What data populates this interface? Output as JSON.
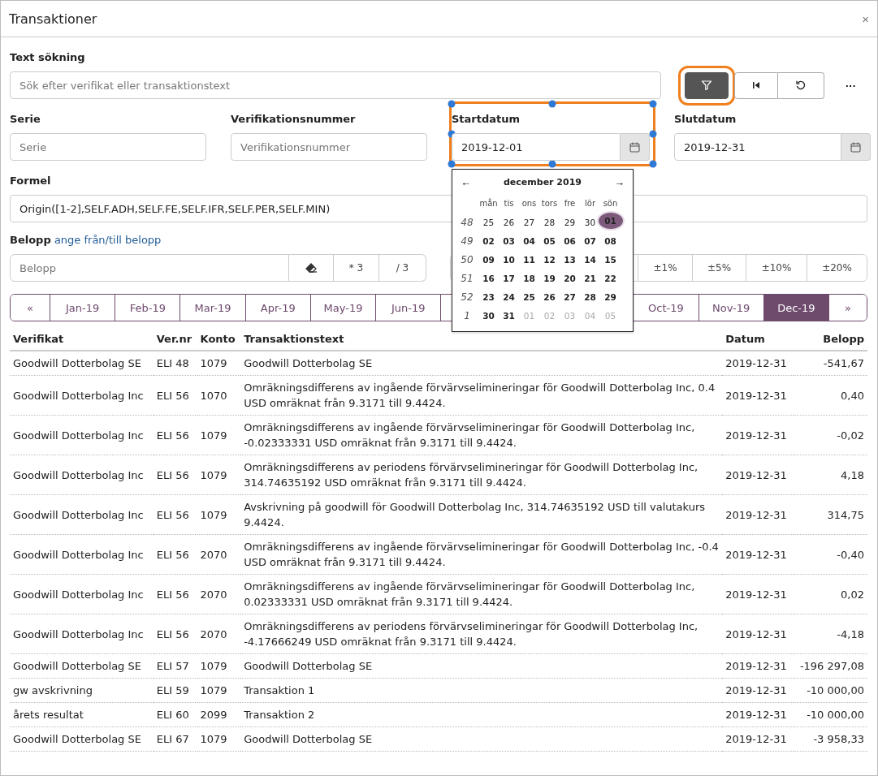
{
  "window": {
    "title": "Transaktioner",
    "close": "×"
  },
  "text_search": {
    "label": "Text sökning",
    "placeholder": "Sök efter verifikat eller transaktionstext"
  },
  "toolbar": {
    "buttons": [
      {
        "kind": "filter",
        "highlighted": true
      },
      {
        "kind": "first",
        "highlighted": false
      },
      {
        "kind": "reset",
        "highlighted": false
      }
    ],
    "more": "···"
  },
  "fields": [
    {
      "label": "Serie",
      "placeholder": "Serie",
      "kind": "text"
    },
    {
      "label": "Verifikationsnummer",
      "placeholder": "Verifikationsnummer",
      "kind": "text"
    },
    {
      "label": "Startdatum",
      "value": "2019-12-01",
      "kind": "date",
      "highlighted": true
    },
    {
      "label": "Slutdatum",
      "value": "2019-12-31",
      "kind": "date"
    }
  ],
  "calendar": {
    "title": "december 2019",
    "prev": "←",
    "next": "→",
    "weekdays": [
      "mån",
      "tis",
      "ons",
      "tors",
      "fre",
      "lör",
      "sön"
    ],
    "weeks": [
      {
        "week": "48",
        "days": [
          {
            "d": "25",
            "kind": "prev",
            "selected": false
          },
          {
            "d": "26",
            "kind": "prev",
            "selected": false
          },
          {
            "d": "27",
            "kind": "prev",
            "selected": false
          },
          {
            "d": "28",
            "kind": "prev",
            "selected": false
          },
          {
            "d": "29",
            "kind": "prev",
            "selected": false
          },
          {
            "d": "30",
            "kind": "prev",
            "selected": false
          },
          {
            "d": "01",
            "kind": "cur",
            "selected": true
          }
        ]
      },
      {
        "week": "49",
        "days": [
          {
            "d": "02",
            "kind": "cur",
            "selected": false
          },
          {
            "d": "03",
            "kind": "cur",
            "selected": false
          },
          {
            "d": "04",
            "kind": "cur",
            "selected": false
          },
          {
            "d": "05",
            "kind": "cur",
            "selected": false
          },
          {
            "d": "06",
            "kind": "cur",
            "selected": false
          },
          {
            "d": "07",
            "kind": "cur",
            "selected": false
          },
          {
            "d": "08",
            "kind": "cur",
            "selected": false
          }
        ]
      },
      {
        "week": "50",
        "days": [
          {
            "d": "09",
            "kind": "cur",
            "selected": false
          },
          {
            "d": "10",
            "kind": "cur",
            "selected": false
          },
          {
            "d": "11",
            "kind": "cur",
            "selected": false
          },
          {
            "d": "12",
            "kind": "cur",
            "selected": false
          },
          {
            "d": "13",
            "kind": "cur",
            "selected": false
          },
          {
            "d": "14",
            "kind": "cur",
            "selected": false
          },
          {
            "d": "15",
            "kind": "cur",
            "selected": false
          }
        ]
      },
      {
        "week": "51",
        "days": [
          {
            "d": "16",
            "kind": "cur",
            "selected": false
          },
          {
            "d": "17",
            "kind": "cur",
            "selected": false
          },
          {
            "d": "18",
            "kind": "cur",
            "selected": false
          },
          {
            "d": "19",
            "kind": "cur",
            "selected": false
          },
          {
            "d": "20",
            "kind": "cur",
            "selected": false
          },
          {
            "d": "21",
            "kind": "cur",
            "selected": false
          },
          {
            "d": "22",
            "kind": "cur",
            "selected": false
          }
        ]
      },
      {
        "week": "52",
        "days": [
          {
            "d": "23",
            "kind": "cur",
            "selected": false
          },
          {
            "d": "24",
            "kind": "cur",
            "selected": false
          },
          {
            "d": "25",
            "kind": "cur",
            "selected": false
          },
          {
            "d": "26",
            "kind": "cur",
            "selected": false
          },
          {
            "d": "27",
            "kind": "cur",
            "selected": false
          },
          {
            "d": "28",
            "kind": "cur",
            "selected": false
          },
          {
            "d": "29",
            "kind": "cur",
            "selected": false
          }
        ]
      },
      {
        "week": "1",
        "days": [
          {
            "d": "30",
            "kind": "cur",
            "selected": false
          },
          {
            "d": "31",
            "kind": "cur",
            "selected": false
          },
          {
            "d": "01",
            "kind": "next",
            "selected": false
          },
          {
            "d": "02",
            "kind": "next",
            "selected": false
          },
          {
            "d": "03",
            "kind": "next",
            "selected": false
          },
          {
            "d": "04",
            "kind": "next",
            "selected": false
          },
          {
            "d": "05",
            "kind": "next",
            "selected": false
          }
        ]
      }
    ]
  },
  "formula": {
    "label": "Formel",
    "value": "Origin([1-2],SELF.ADH,SELF.FE,SELF.IFR,SELF.PER,SELF.MIN)"
  },
  "amount": {
    "label": "Belopp",
    "link": "ange från/till belopp",
    "placeholder": "Belopp",
    "buttons": [
      {
        "kind": "eraser"
      },
      {
        "kind": "text",
        "label": "* 3"
      },
      {
        "kind": "text",
        "label": "/ 3"
      }
    ],
    "percent_buttons": [
      "±1%",
      "±5%",
      "±10%",
      "±20%"
    ]
  },
  "month_bar": {
    "start": [
      {
        "label": "«",
        "selected": false
      },
      {
        "label": "Jan-19",
        "selected": false
      },
      {
        "label": "Feb-19",
        "selected": false
      },
      {
        "label": "Mar-19",
        "selected": false
      },
      {
        "label": "Apr-19",
        "selected": false
      },
      {
        "label": "May-19",
        "selected": false
      },
      {
        "label": "Jun-19",
        "selected": false
      }
    ],
    "end": [
      {
        "label": "Oct-19",
        "selected": false
      },
      {
        "label": "Nov-19",
        "selected": false
      },
      {
        "label": "Dec-19",
        "selected": true
      },
      {
        "label": "»",
        "selected": false
      }
    ]
  },
  "table": {
    "columns": [
      "Verifikat",
      "Ver.nr",
      "Konto",
      "Transaktionstext",
      "Datum",
      "Belopp"
    ],
    "rows": [
      [
        "Goodwill Dotterbolag SE",
        "ELI 48",
        "1079",
        "Goodwill Dotterbolag SE",
        "2019-12-31",
        "-541,67"
      ],
      [
        "Goodwill Dotterbolag Inc",
        "ELI 56",
        "1070",
        "Omräkningsdifferens av ingående förvärvselimineringar för Goodwill Dotterbolag Inc, 0.4 USD omräknat från 9.3171 till 9.4424.",
        "2019-12-31",
        "0,40"
      ],
      [
        "Goodwill Dotterbolag Inc",
        "ELI 56",
        "1079",
        "Omräkningsdifferens av ingående förvärvselimineringar för Goodwill Dotterbolag Inc, -0.02333331 USD omräknat från 9.3171 till 9.4424.",
        "2019-12-31",
        "-0,02"
      ],
      [
        "Goodwill Dotterbolag Inc",
        "ELI 56",
        "1079",
        "Omräkningsdifferens av periodens förvärvselimineringar för Goodwill Dotterbolag Inc, 314.74635192 USD omräknat från 9.3171 till 9.4424.",
        "2019-12-31",
        "4,18"
      ],
      [
        "Goodwill Dotterbolag Inc",
        "ELI 56",
        "1079",
        "Avskrivning på goodwill för Goodwill Dotterbolag Inc, 314.74635192 USD till valutakurs 9.4424.",
        "2019-12-31",
        "314,75"
      ],
      [
        "Goodwill Dotterbolag Inc",
        "ELI 56",
        "2070",
        "Omräkningsdifferens av ingående förvärvselimineringar för Goodwill Dotterbolag Inc, -0.4 USD omräknat från 9.3171 till 9.4424.",
        "2019-12-31",
        "-0,40"
      ],
      [
        "Goodwill Dotterbolag Inc",
        "ELI 56",
        "2070",
        "Omräkningsdifferens av ingående förvärvselimineringar för Goodwill Dotterbolag Inc, 0.02333331 USD omräknat från 9.3171 till 9.4424.",
        "2019-12-31",
        "0,02"
      ],
      [
        "Goodwill Dotterbolag Inc",
        "ELI 56",
        "2070",
        "Omräkningsdifferens av periodens förvärvselimineringar för Goodwill Dotterbolag Inc, -4.17666249 USD omräknat från 9.3171 till 9.4424.",
        "2019-12-31",
        "-4,18"
      ],
      [
        "Goodwill Dotterbolag SE",
        "ELI 57",
        "1079",
        "Goodwill Dotterbolag SE",
        "2019-12-31",
        "-196 297,08"
      ],
      [
        "gw avskrivning",
        "ELI 59",
        "1079",
        "Transaktion 1",
        "2019-12-31",
        "-10 000,00"
      ],
      [
        "årets resultat",
        "ELI 60",
        "2099",
        "Transaktion 2",
        "2019-12-31",
        "-10 000,00"
      ],
      [
        "Goodwill Dotterbolag SE",
        "ELI 67",
        "1079",
        "Goodwill Dotterbolag SE",
        "2019-12-31",
        "-3 958,33"
      ]
    ]
  }
}
